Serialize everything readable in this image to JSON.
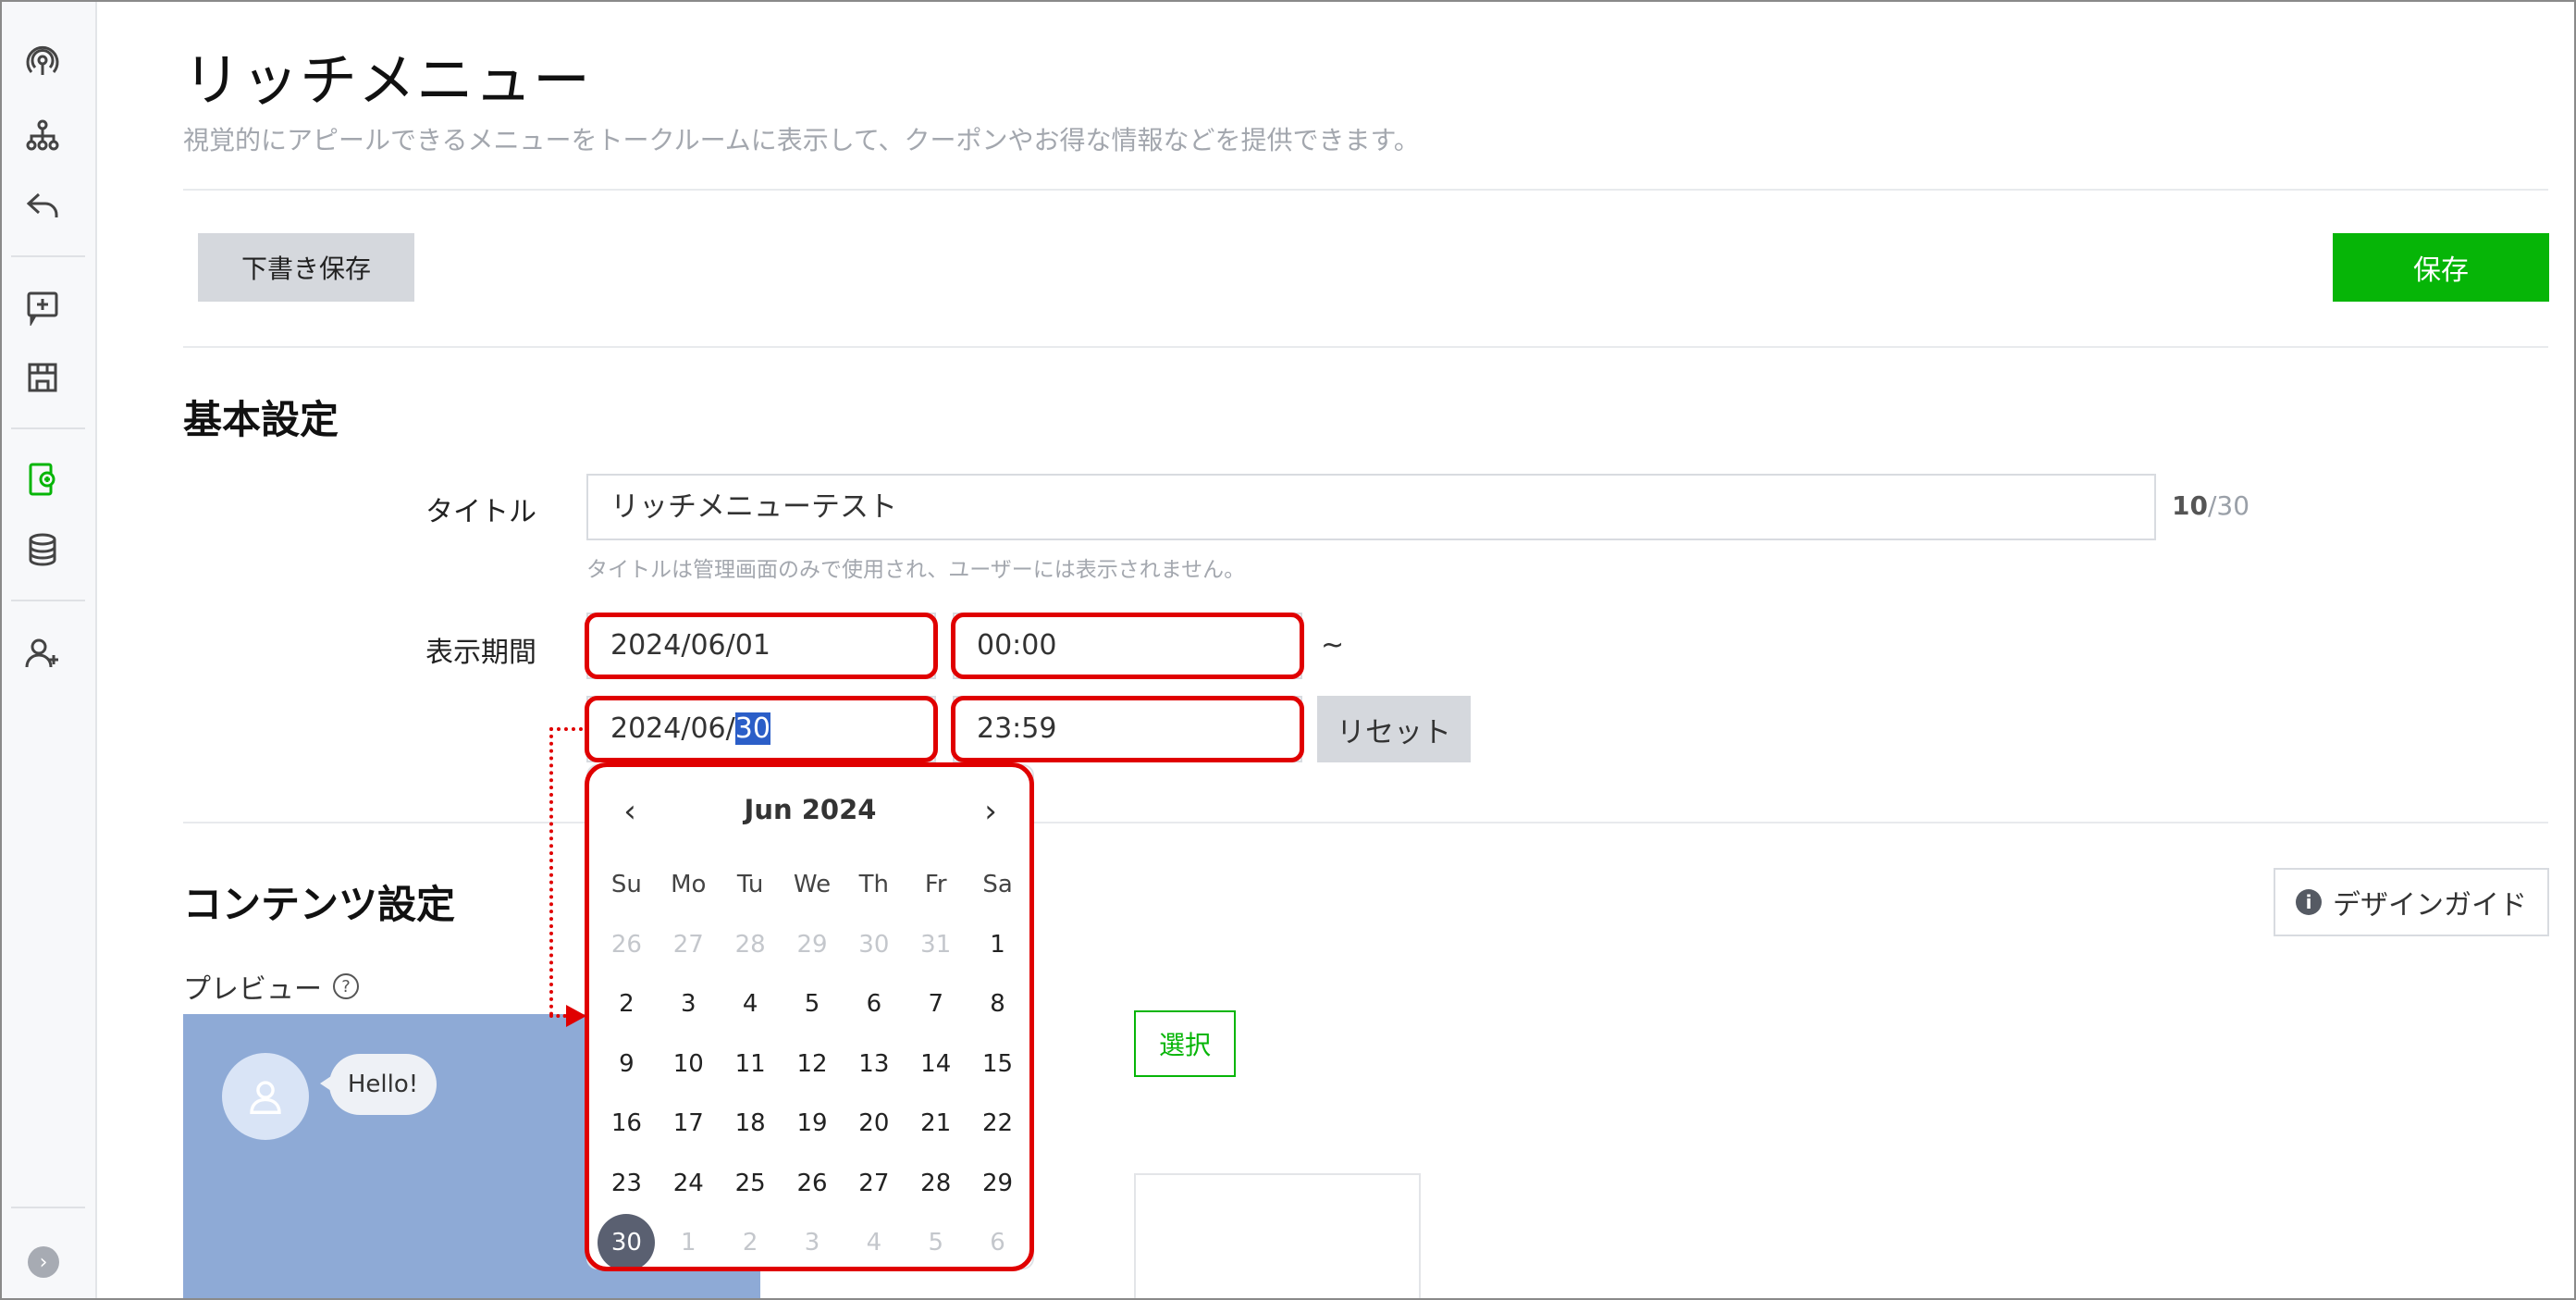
{
  "sidebar": {
    "icons": [
      "broadcast-icon",
      "sitemap-icon",
      "reply-icon",
      "message-plus-icon",
      "store-icon",
      "rich-menu-icon",
      "database-icon",
      "user-plus-icon"
    ],
    "expand_label": "›"
  },
  "header": {
    "title": "リッチメニュー",
    "description": "視覚的にアピールできるメニューをトークルームに表示して、クーポンやお得な情報などを提供できます。"
  },
  "toolbar": {
    "draft_label": "下書き保存",
    "save_label": "保存"
  },
  "basic": {
    "section_title": "基本設定",
    "title_label": "タイトル",
    "title_value": "リッチメニューテスト",
    "title_count": "10",
    "title_max": "/30",
    "title_hint": "タイトルは管理画面のみで使用され、ユーザーには表示されません。",
    "period_label": "表示期間",
    "start_date": "2024/06/01",
    "start_time": "00:00",
    "tilde": "~",
    "end_date_prefix": "2024/06/",
    "end_date_selected": "30",
    "end_time": "23:59",
    "reset_label": "リセット"
  },
  "calendar": {
    "prev": "‹",
    "next": "›",
    "month_label": "Jun 2024",
    "weekdays": [
      "Su",
      "Mo",
      "Tu",
      "We",
      "Th",
      "Fr",
      "Sa"
    ],
    "days": [
      {
        "d": "26",
        "out": true
      },
      {
        "d": "27",
        "out": true
      },
      {
        "d": "28",
        "out": true
      },
      {
        "d": "29",
        "out": true
      },
      {
        "d": "30",
        "out": true
      },
      {
        "d": "31",
        "out": true
      },
      {
        "d": "1"
      },
      {
        "d": "2"
      },
      {
        "d": "3"
      },
      {
        "d": "4"
      },
      {
        "d": "5"
      },
      {
        "d": "6"
      },
      {
        "d": "7"
      },
      {
        "d": "8"
      },
      {
        "d": "9"
      },
      {
        "d": "10"
      },
      {
        "d": "11"
      },
      {
        "d": "12"
      },
      {
        "d": "13"
      },
      {
        "d": "14"
      },
      {
        "d": "15"
      },
      {
        "d": "16"
      },
      {
        "d": "17"
      },
      {
        "d": "18"
      },
      {
        "d": "19"
      },
      {
        "d": "20"
      },
      {
        "d": "21"
      },
      {
        "d": "22"
      },
      {
        "d": "23"
      },
      {
        "d": "24"
      },
      {
        "d": "25"
      },
      {
        "d": "26"
      },
      {
        "d": "27"
      },
      {
        "d": "28"
      },
      {
        "d": "29"
      },
      {
        "d": "30",
        "selected": true
      },
      {
        "d": "1",
        "out": true
      },
      {
        "d": "2",
        "out": true
      },
      {
        "d": "3",
        "out": true
      },
      {
        "d": "4",
        "out": true
      },
      {
        "d": "5",
        "out": true
      },
      {
        "d": "6",
        "out": true
      }
    ]
  },
  "content": {
    "section_title": "コンテンツ設定",
    "design_guide_label": "デザインガイド",
    "info_icon": "i",
    "preview_label": "プレビュー",
    "help_icon": "?",
    "bubble_text": "Hello!",
    "select_label": "選択"
  },
  "colors": {
    "accent_green": "#06b507",
    "highlight_red": "#e00000",
    "preview_bg": "#8eaad6",
    "selected_day": "#5a6071"
  }
}
